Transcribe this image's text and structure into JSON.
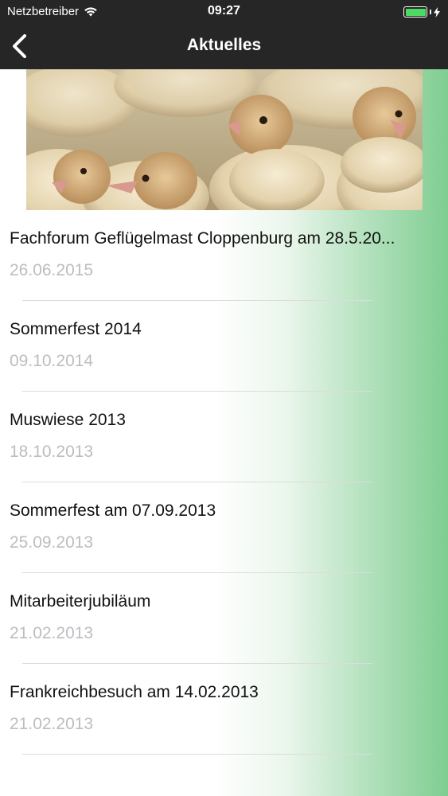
{
  "status_bar": {
    "carrier": "Netzbetreiber",
    "time": "09:27",
    "wifi_icon": "wifi-icon",
    "battery_icon": "battery-icon",
    "charging_icon": "charging-bolt-icon"
  },
  "nav": {
    "title": "Aktuelles",
    "back_icon": "chevron-left-icon"
  },
  "hero": {
    "alt": "turkey chicks photo"
  },
  "news": [
    {
      "title": "Fachforum Geflügelmast Cloppenburg am 28.5.20...",
      "date": "26.06.2015"
    },
    {
      "title": "Sommerfest 2014",
      "date": "09.10.2014"
    },
    {
      "title": "Muswiese 2013",
      "date": "18.10.2013"
    },
    {
      "title": "Sommerfest am 07.09.2013",
      "date": "25.09.2013"
    },
    {
      "title": "Mitarbeiterjubiläum",
      "date": "21.02.2013"
    },
    {
      "title": "Frankreichbesuch am 14.02.2013",
      "date": "21.02.2013"
    }
  ],
  "colors": {
    "bar_background": "#262626",
    "accent_green": "#7fcd91",
    "date_gray": "#bdbdc2"
  }
}
